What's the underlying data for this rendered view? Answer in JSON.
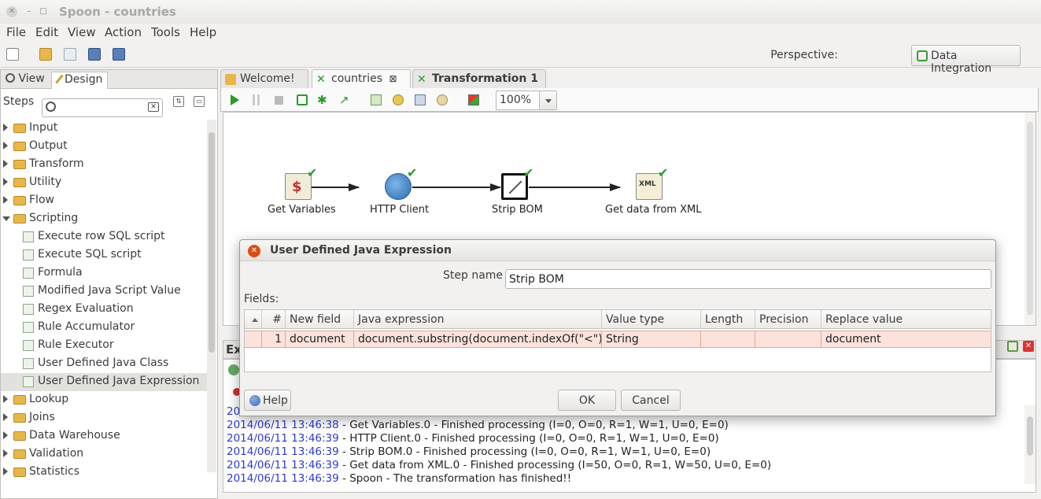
{
  "window": {
    "title": "Spoon - countries"
  },
  "menu": [
    "File",
    "Edit",
    "View",
    "Action",
    "Tools",
    "Help"
  ],
  "perspective": {
    "label": "Perspective:",
    "button": "Data Integration"
  },
  "left_panel": {
    "tabs": [
      "View",
      "Design"
    ],
    "steps_label": "Steps",
    "search_placeholder": "",
    "tree": [
      {
        "label": "Input",
        "type": "folder"
      },
      {
        "label": "Output",
        "type": "folder"
      },
      {
        "label": "Transform",
        "type": "folder"
      },
      {
        "label": "Utility",
        "type": "folder"
      },
      {
        "label": "Flow",
        "type": "folder"
      },
      {
        "label": "Scripting",
        "type": "folder",
        "open": true
      },
      {
        "label": "Execute row SQL script",
        "type": "child"
      },
      {
        "label": "Execute SQL script",
        "type": "child"
      },
      {
        "label": "Formula",
        "type": "child"
      },
      {
        "label": "Modified Java Script Value",
        "type": "child"
      },
      {
        "label": "Regex Evaluation",
        "type": "child"
      },
      {
        "label": "Rule Accumulator",
        "type": "child"
      },
      {
        "label": "Rule Executor",
        "type": "child"
      },
      {
        "label": "User Defined Java Class",
        "type": "child"
      },
      {
        "label": "User Defined Java Expression",
        "type": "child",
        "selected": true
      },
      {
        "label": "Lookup",
        "type": "folder"
      },
      {
        "label": "Joins",
        "type": "folder"
      },
      {
        "label": "Data Warehouse",
        "type": "folder"
      },
      {
        "label": "Validation",
        "type": "folder"
      },
      {
        "label": "Statistics",
        "type": "folder"
      }
    ]
  },
  "editor_tabs": [
    "Welcome!",
    "countries",
    "Transformation 1"
  ],
  "zoom": "100%",
  "canvas": {
    "nodes": [
      "Get Variables",
      "HTTP Client",
      "Strip BOM",
      "Get data from XML"
    ]
  },
  "exec": {
    "title": "Ex",
    "log": [
      {
        "ts": "2014/06/11 13:46:38",
        "msg": " - Get Variables.0 - Finished processing (I=0, O=0, R=1, W=1, U=0, E=0)"
      },
      {
        "ts": "2014/06/11 13:46:39",
        "msg": " - HTTP Client.0 - Finished processing (I=0, O=0, R=1, W=1, U=0, E=0)"
      },
      {
        "ts": "2014/06/11 13:46:39",
        "msg": " - Strip BOM.0 - Finished processing (I=0, O=0, R=1, W=1, U=0, E=0)"
      },
      {
        "ts": "2014/06/11 13:46:39",
        "msg": " - Get data from XML.0 - Finished processing (I=50, O=0, R=1, W=50, U=0, E=0)"
      },
      {
        "ts": "2014/06/11 13:46:39",
        "msg": " - Spoon - The transformation has finished!!"
      }
    ],
    "partial_ts": "2014/"
  },
  "dialog": {
    "title": "User Defined Java Expression",
    "step_name_label": "Step name",
    "step_name_value": "Strip BOM",
    "fields_label": "Fields:",
    "columns": [
      "#",
      "New field",
      "Java expression",
      "Value type",
      "Length",
      "Precision",
      "Replace value"
    ],
    "rows": [
      {
        "num": "1",
        "new_field": "document",
        "java_expression": "document.substring(document.indexOf(\"<\"))",
        "value_type": "String",
        "length": "",
        "precision": "",
        "replace_value": "document"
      }
    ],
    "buttons": {
      "help": "Help",
      "ok": "OK",
      "cancel": "Cancel"
    }
  }
}
